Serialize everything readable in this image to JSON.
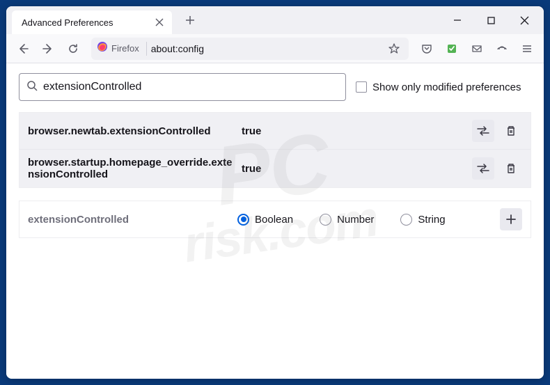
{
  "window": {
    "tab_title": "Advanced Preferences"
  },
  "addressbar": {
    "identity_label": "Firefox",
    "url": "about:config"
  },
  "search": {
    "value": "extensionControlled",
    "show_modified_label": "Show only modified preferences"
  },
  "prefs": [
    {
      "name": "browser.newtab.extensionControlled",
      "value": "true"
    },
    {
      "name": "browser.startup.homepage_override.extensionControlled",
      "value": "true"
    }
  ],
  "new_pref": {
    "name": "extensionControlled",
    "types": {
      "boolean": "Boolean",
      "number": "Number",
      "string": "String"
    }
  },
  "watermark": {
    "line1": "PC",
    "line2": "risk.com"
  }
}
